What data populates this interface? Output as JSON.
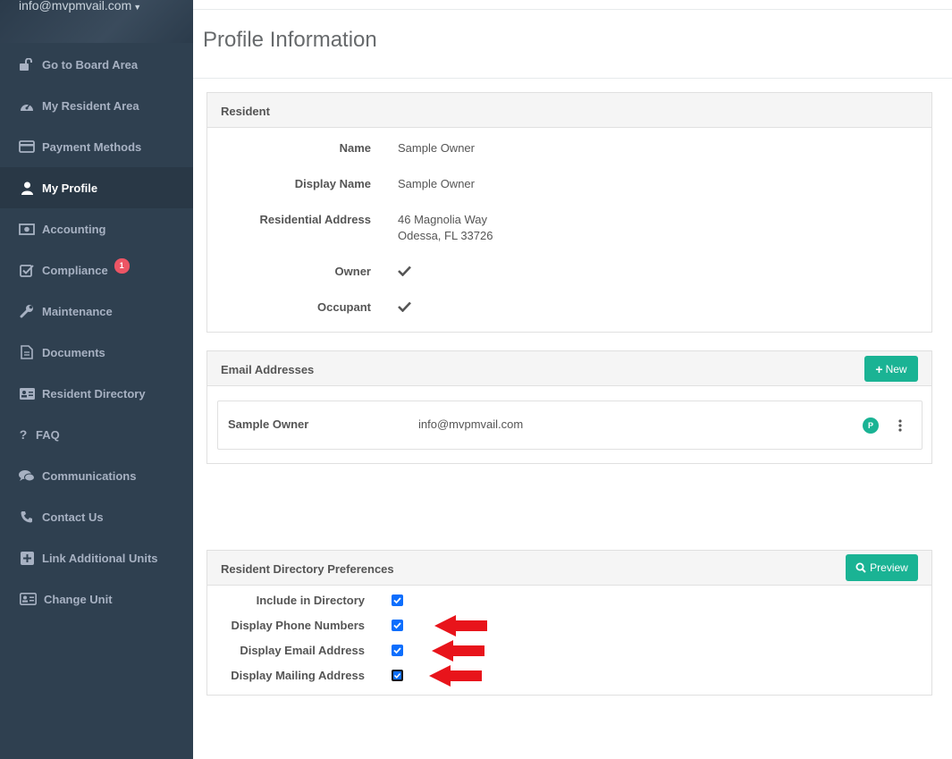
{
  "user": {
    "email": "info@mvpmvail.com"
  },
  "nav": [
    {
      "label": "Go to Board Area",
      "icon": "unlock-icon",
      "active": false
    },
    {
      "label": "My Resident Area",
      "icon": "dashboard-icon",
      "active": false
    },
    {
      "label": "Payment Methods",
      "icon": "credit-card-icon",
      "active": false
    },
    {
      "label": "My Profile",
      "icon": "user-icon",
      "active": true
    },
    {
      "label": "Accounting",
      "icon": "money-icon",
      "active": false
    },
    {
      "label": "Compliance",
      "icon": "check-square-icon",
      "active": false,
      "badge": "1"
    },
    {
      "label": "Maintenance",
      "icon": "wrench-icon",
      "active": false
    },
    {
      "label": "Documents",
      "icon": "file-icon",
      "active": false
    },
    {
      "label": "Resident Directory",
      "icon": "address-card-icon",
      "active": false
    },
    {
      "label": "FAQ",
      "icon": "question-icon",
      "active": false
    },
    {
      "label": "Communications",
      "icon": "comments-icon",
      "active": false
    },
    {
      "label": "Contact Us",
      "icon": "phone-icon",
      "active": false
    },
    {
      "label": "Link Additional Units",
      "icon": "plus-square-icon",
      "active": false
    },
    {
      "label": "Change Unit",
      "icon": "id-card-icon",
      "active": false
    }
  ],
  "page": {
    "title": "Profile Information"
  },
  "resident": {
    "heading": "Resident",
    "fields": {
      "name_label": "Name",
      "name_value": "Sample Owner",
      "display_name_label": "Display Name",
      "display_name_value": "Sample Owner",
      "address_label": "Residential Address",
      "address_line1": "46 Magnolia Way",
      "address_line2": "Odessa, FL 33726",
      "owner_label": "Owner",
      "owner_checked": true,
      "occupant_label": "Occupant",
      "occupant_checked": true
    }
  },
  "emails": {
    "heading": "Email Addresses",
    "new_button": "New",
    "rows": [
      {
        "name": "Sample Owner",
        "email": "info@mvpmvail.com",
        "primary_badge": "P"
      }
    ]
  },
  "directory_prefs": {
    "heading": "Resident Directory Preferences",
    "preview_button": "Preview",
    "items": [
      {
        "label": "Include in Directory",
        "checked": true
      },
      {
        "label": "Display Phone Numbers",
        "checked": true
      },
      {
        "label": "Display Email Address",
        "checked": true
      },
      {
        "label": "Display Mailing Address",
        "checked": true
      }
    ]
  },
  "colors": {
    "sidebar": "#2f4050",
    "accent": "#1ab394",
    "badge": "#ed5565",
    "arrow": "#e8141b",
    "checkbox": "#0d6efd"
  }
}
